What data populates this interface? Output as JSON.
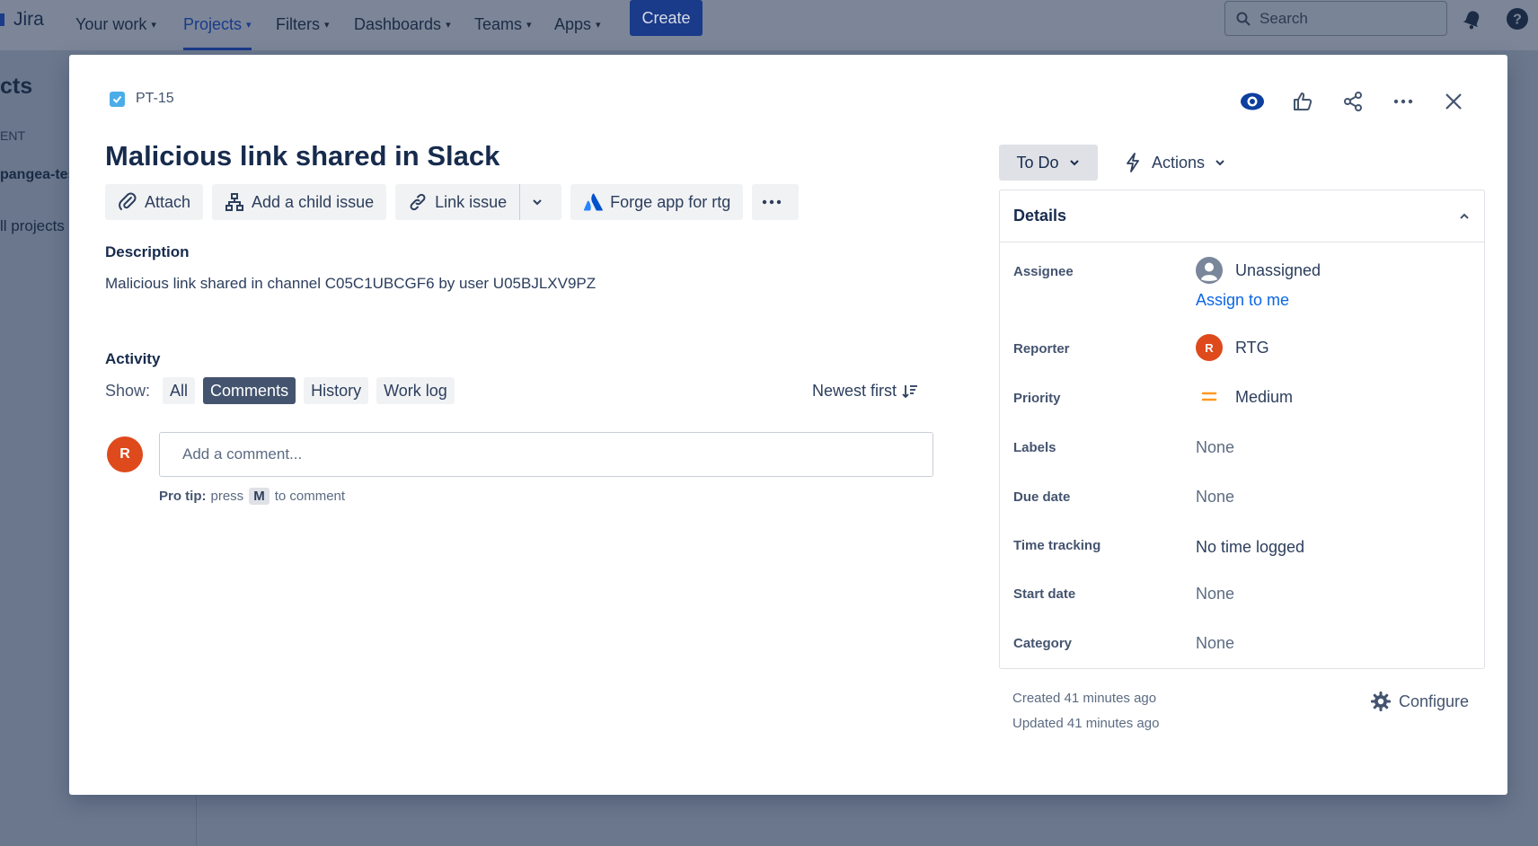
{
  "nav": {
    "logo": "Jira",
    "items": [
      {
        "label": "Your work"
      },
      {
        "label": "Projects"
      },
      {
        "label": "Filters"
      },
      {
        "label": "Dashboards"
      },
      {
        "label": "Teams"
      },
      {
        "label": "Apps"
      }
    ],
    "create_label": "Create",
    "search_placeholder": "Search",
    "icons": [
      "search-icon",
      "notification-icon",
      "help-icon"
    ]
  },
  "background_sidebar": {
    "title": "cts",
    "subtitle": "ENT",
    "project": "pangea-tes",
    "all_projects": "ll projects"
  },
  "issue": {
    "key": "PT-15",
    "type_icon": "task-checkbox-icon",
    "title": "Malicious link shared in Slack",
    "top_icons": [
      "watch-icon",
      "like-icon",
      "share-icon",
      "more-icon",
      "close-icon"
    ],
    "toolbar": {
      "attach": "Attach",
      "add_child": "Add a child issue",
      "link_issue": "Link issue",
      "forge_app": "Forge app for rtg"
    },
    "description_label": "Description",
    "description": "Malicious link shared in channel C05C1UBCGF6 by user U05BJLXV9PZ",
    "activity_label": "Activity",
    "show_label": "Show:",
    "filters": {
      "all": "All",
      "comments": "Comments",
      "history": "History",
      "work_log": "Work log"
    },
    "sort_label": "Newest first",
    "comment_avatar": "R",
    "comment_placeholder": "Add a comment...",
    "protip": {
      "bold": "Pro tip:",
      "press": "press",
      "key": "M",
      "suffix": "to comment"
    }
  },
  "sidebar": {
    "status": "To Do",
    "actions": "Actions",
    "details_title": "Details",
    "fields": {
      "assignee_label": "Assignee",
      "assignee_value": "Unassigned",
      "assign_to_me": "Assign to me",
      "reporter_label": "Reporter",
      "reporter_avatar": "R",
      "reporter_value": "RTG",
      "priority_label": "Priority",
      "priority_value": "Medium",
      "labels_label": "Labels",
      "labels_value": "None",
      "due_label": "Due date",
      "due_value": "None",
      "time_label": "Time tracking",
      "time_value": "No time logged",
      "start_label": "Start date",
      "start_value": "None",
      "category_label": "Category",
      "category_value": "None"
    },
    "created": "Created 41 minutes ago",
    "updated": "Updated 41 minutes ago",
    "configure": "Configure"
  },
  "colors": {
    "brand": "#1a3a8a",
    "avatar": "#de4a1c",
    "link": "#0c66e4",
    "priority_medium": "#ff991f"
  }
}
